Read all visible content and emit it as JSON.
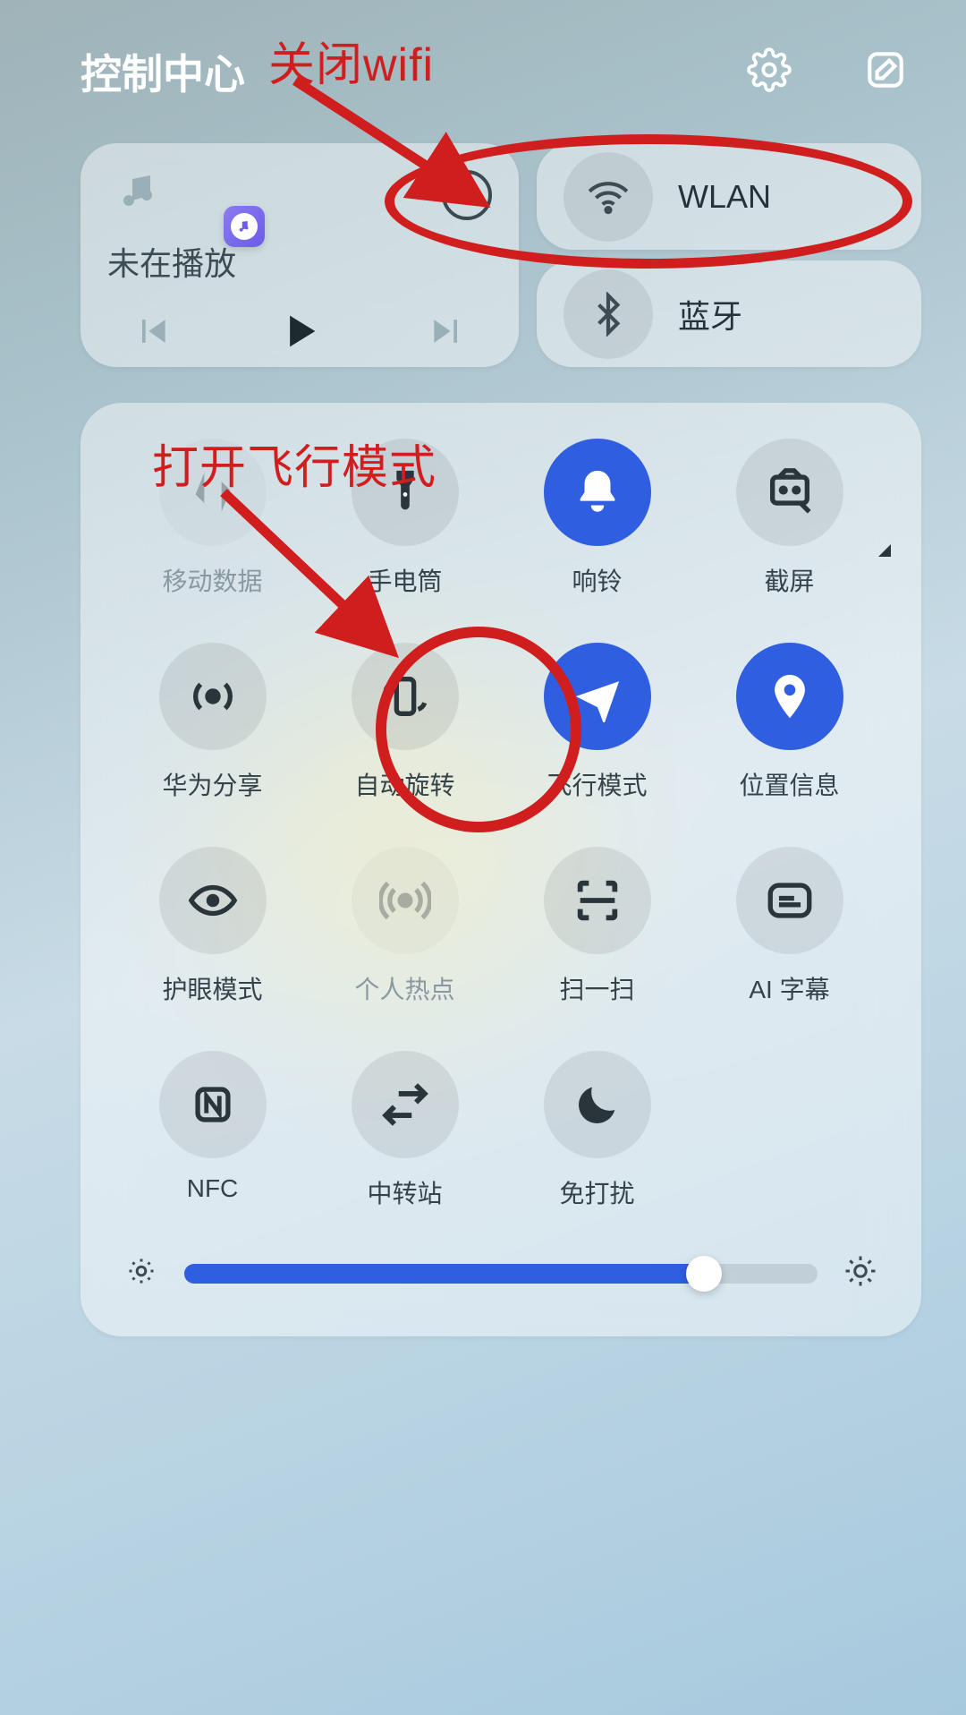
{
  "header": {
    "title": "控制中心",
    "settings_icon": "gear-icon",
    "edit_icon": "edit-icon"
  },
  "media": {
    "status": "未在播放"
  },
  "wlan": {
    "label": "WLAN"
  },
  "bluetooth": {
    "label": "蓝牙"
  },
  "toggles": {
    "mobile_data": "移动数据",
    "flashlight": "手电筒",
    "ring": "响铃",
    "screenshot": "截屏",
    "huawei_share": "华为分享",
    "auto_rotate": "自动旋转",
    "airplane": "飞行模式",
    "location": "位置信息",
    "eye_comfort": "护眼模式",
    "hotspot": "个人热点",
    "scan": "扫一扫",
    "ai_sub": "AI 字幕",
    "nfc": "NFC",
    "transfer": "中转站",
    "dnd": "免打扰"
  },
  "annotations": {
    "close_wifi": "关闭wifi",
    "open_airplane": "打开飞行模式"
  },
  "brightness": {
    "value_percent": 82
  }
}
